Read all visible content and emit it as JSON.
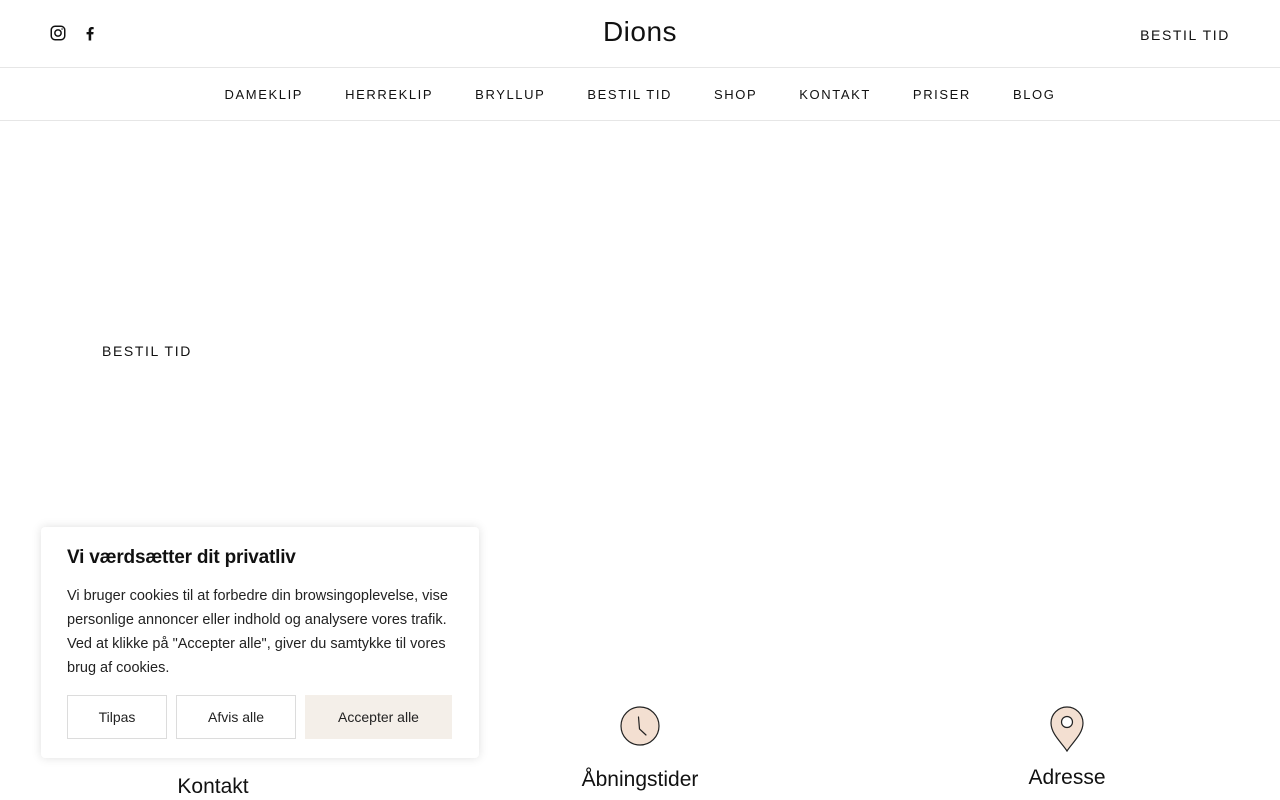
{
  "header": {
    "logo": "Dions",
    "cta": "BESTIL TID",
    "social": [
      {
        "icon": "instagram-icon"
      },
      {
        "icon": "facebook-icon"
      }
    ]
  },
  "nav": {
    "items": [
      "DAMEKLIP",
      "HERREKLIP",
      "BRYLLUP",
      "BESTIL TID",
      "SHOP",
      "KONTAKT",
      "PRISER",
      "BLOG"
    ]
  },
  "hero": {
    "cta": "BESTIL TID"
  },
  "info": {
    "contact": {
      "label": "Kontakt",
      "icon": "phone-icon"
    },
    "hours": {
      "label": "Åbningstider",
      "icon": "clock-icon"
    },
    "address": {
      "label": "Adresse",
      "icon": "map-pin-icon"
    }
  },
  "cookie": {
    "title": "Vi værdsætter dit privatliv",
    "text": "Vi bruger cookies til at forbedre din browsingoplevelse, vise personlige annoncer eller indhold og analysere vores trafik. Ved at klikke på \"Accepter alle\", giver du samtykke til vores brug af cookies.",
    "buttons": {
      "customize": "Tilpas",
      "reject": "Afvis alle",
      "accept": "Accepter alle"
    }
  },
  "colors": {
    "text": "#111111",
    "accent_fill": "#f3dfd1",
    "accept_button": "#f4efe9",
    "divider": "#e6e6e6"
  }
}
